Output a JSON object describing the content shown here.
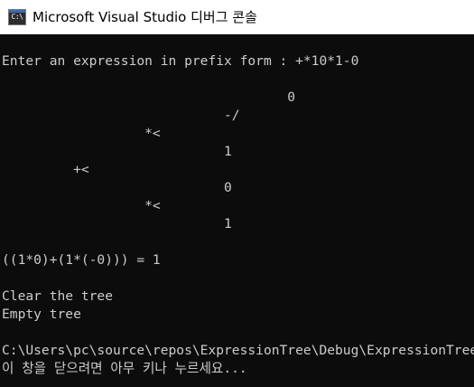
{
  "window": {
    "title": "Microsoft Visual Studio 디버그 콘솔",
    "icon_label": "C:\\",
    "icon": "console-app-icon"
  },
  "console": {
    "lines": [
      "Enter an expression in prefix form : +*10*1-0",
      "                                    0",
      "                            -/",
      "                  *<",
      "                            1",
      "         +<",
      "                            0",
      "                  *<",
      "                            1",
      "((1*0)+(1*(-0))) = 1",
      "Clear the tree",
      "Empty tree",
      "C:\\Users\\pc\\source\\repos\\ExpressionTree\\Debug\\ExpressionTree",
      "이 창을 닫으려면 아무 키나 누르세요..."
    ]
  },
  "colors": {
    "background": "#0c0c0c",
    "text": "#cccccc",
    "titlebar": "#ffffff"
  }
}
